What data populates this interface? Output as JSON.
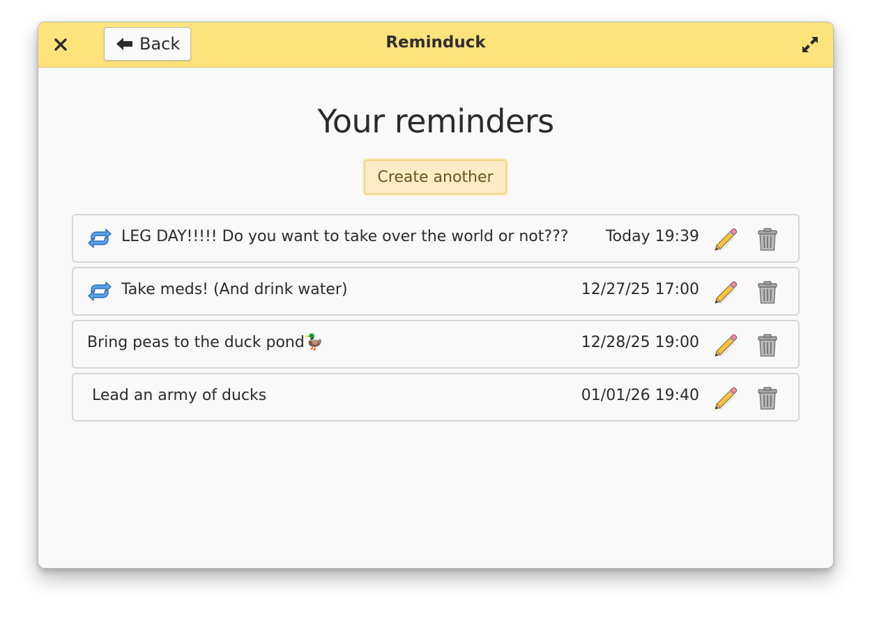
{
  "titlebar": {
    "close_icon": "close-icon",
    "back_label": "Back",
    "back_icon": "arrow-left-icon",
    "app_title": "Reminduck",
    "maximize_icon": "maximize-icon"
  },
  "main": {
    "page_title": "Your reminders",
    "create_label": "Create another"
  },
  "reminders": [
    {
      "text": "LEG DAY!!!!! Do you want to take over the world or not???",
      "time": "Today 19:39",
      "repeating": true
    },
    {
      "text": "Take meds! (And drink water)",
      "time": "12/27/25 17:00",
      "repeating": true
    },
    {
      "text": "Bring peas to the duck pond",
      "emoji": "🦆",
      "time": "12/28/25 19:00",
      "repeating": false
    },
    {
      "text": "Lead an army of ducks",
      "time": "01/01/26 19:40",
      "repeating": false
    }
  ],
  "colors": {
    "titlebar_bg": "#ffe27a",
    "create_bg": "#fbecc5",
    "repeat_icon": "#4a90d9"
  }
}
